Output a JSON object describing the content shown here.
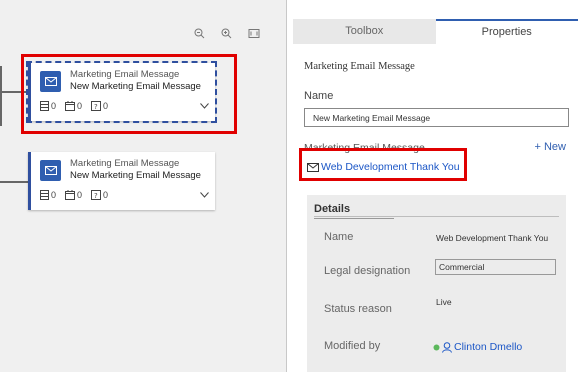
{
  "toolbar": {
    "zoom_out_icon": "zoom-out-icon",
    "zoom_in_icon": "zoom-in-icon",
    "fit_icon": "fit-to-screen-icon"
  },
  "tiles": [
    {
      "type": "Marketing Email Message",
      "name": "New Marketing Email Message",
      "stats": [
        "0",
        "0",
        "0"
      ],
      "selected": true
    },
    {
      "type": "Marketing Email Message",
      "name": "New Marketing Email Message",
      "stats": [
        "0",
        "0",
        "0"
      ],
      "selected": false
    }
  ],
  "panel": {
    "tabs": [
      {
        "label": "Toolbox"
      },
      {
        "label": "Properties"
      }
    ],
    "section_title": "Marketing Email Message",
    "name_label": "Name",
    "name_value": "New Marketing Email Message",
    "lookup_label": "Marketing Email Message",
    "new_label": "+ New",
    "lookup_value": "Web Development Thank You",
    "details": {
      "title": "Details",
      "name_label": "Name",
      "name_value": "Web Development Thank You",
      "legal_label": "Legal designation",
      "legal_value": "Commercial",
      "status_label": "Status reason",
      "status_value": "Live",
      "modified_label": "Modified by",
      "modified_value": "Clinton Dmello"
    }
  },
  "colors": {
    "accent": "#2f5eb0",
    "highlight": "#e00000",
    "link": "#1b56c6"
  }
}
